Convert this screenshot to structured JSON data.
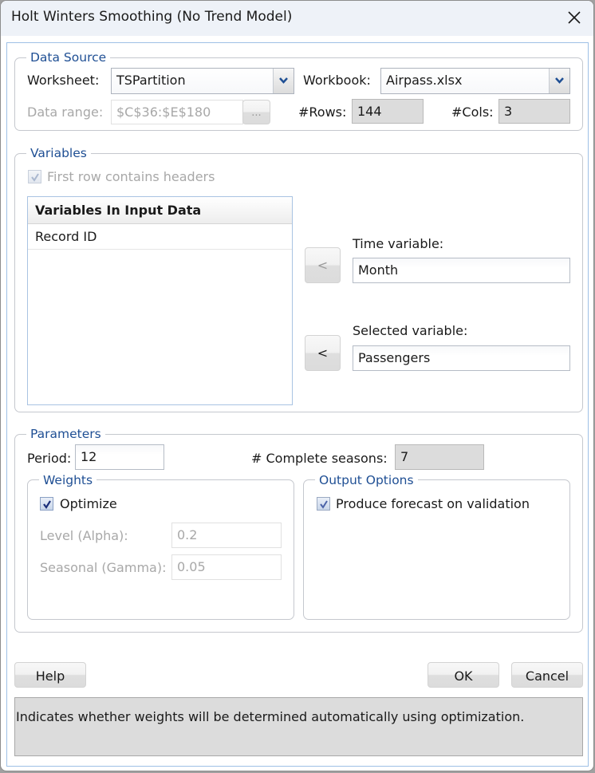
{
  "window": {
    "title": "Holt Winters Smoothing (No Trend Model)",
    "close_icon": "close-icon"
  },
  "data_source": {
    "legend": "Data Source",
    "worksheet_label": "Worksheet:",
    "worksheet_value": "TSPartition",
    "workbook_label": "Workbook:",
    "workbook_value": "Airpass.xlsx",
    "data_range_label": "Data range:",
    "data_range_value": "$C$36:$E$180",
    "browse_label": "...",
    "rows_label": "#Rows:",
    "rows_value": "144",
    "cols_label": "#Cols:",
    "cols_value": "3"
  },
  "variables": {
    "legend": "Variables",
    "first_row_headers_label": "First row contains headers",
    "first_row_headers_checked": true,
    "list_header": "Variables In Input Data",
    "list_items": [
      "Record ID"
    ],
    "move_button_label": "<",
    "time_variable_label": "Time variable:",
    "time_variable_value": "Month",
    "selected_variable_label": "Selected variable:",
    "selected_variable_value": "Passengers"
  },
  "parameters": {
    "legend": "Parameters",
    "period_label": "Period:",
    "period_value": "12",
    "complete_seasons_label": "# Complete seasons:",
    "complete_seasons_value": "7",
    "weights": {
      "legend": "Weights",
      "optimize_label": "Optimize",
      "optimize_checked": true,
      "alpha_label": "Level (Alpha):",
      "alpha_value": "0.2",
      "gamma_label": "Seasonal (Gamma):",
      "gamma_value": "0.05"
    },
    "output_options": {
      "legend": "Output Options",
      "forecast_validation_label": "Produce forecast on validation",
      "forecast_validation_checked": true
    }
  },
  "buttons": {
    "help": "Help",
    "ok": "OK",
    "cancel": "Cancel"
  },
  "status_text": "Indicates whether weights will be determined automatically using optimization.",
  "colors": {
    "accent_legend": "#1f4f94",
    "titlebar_bg": "#eef2f8",
    "readonly_bg": "#dcdcdc"
  }
}
